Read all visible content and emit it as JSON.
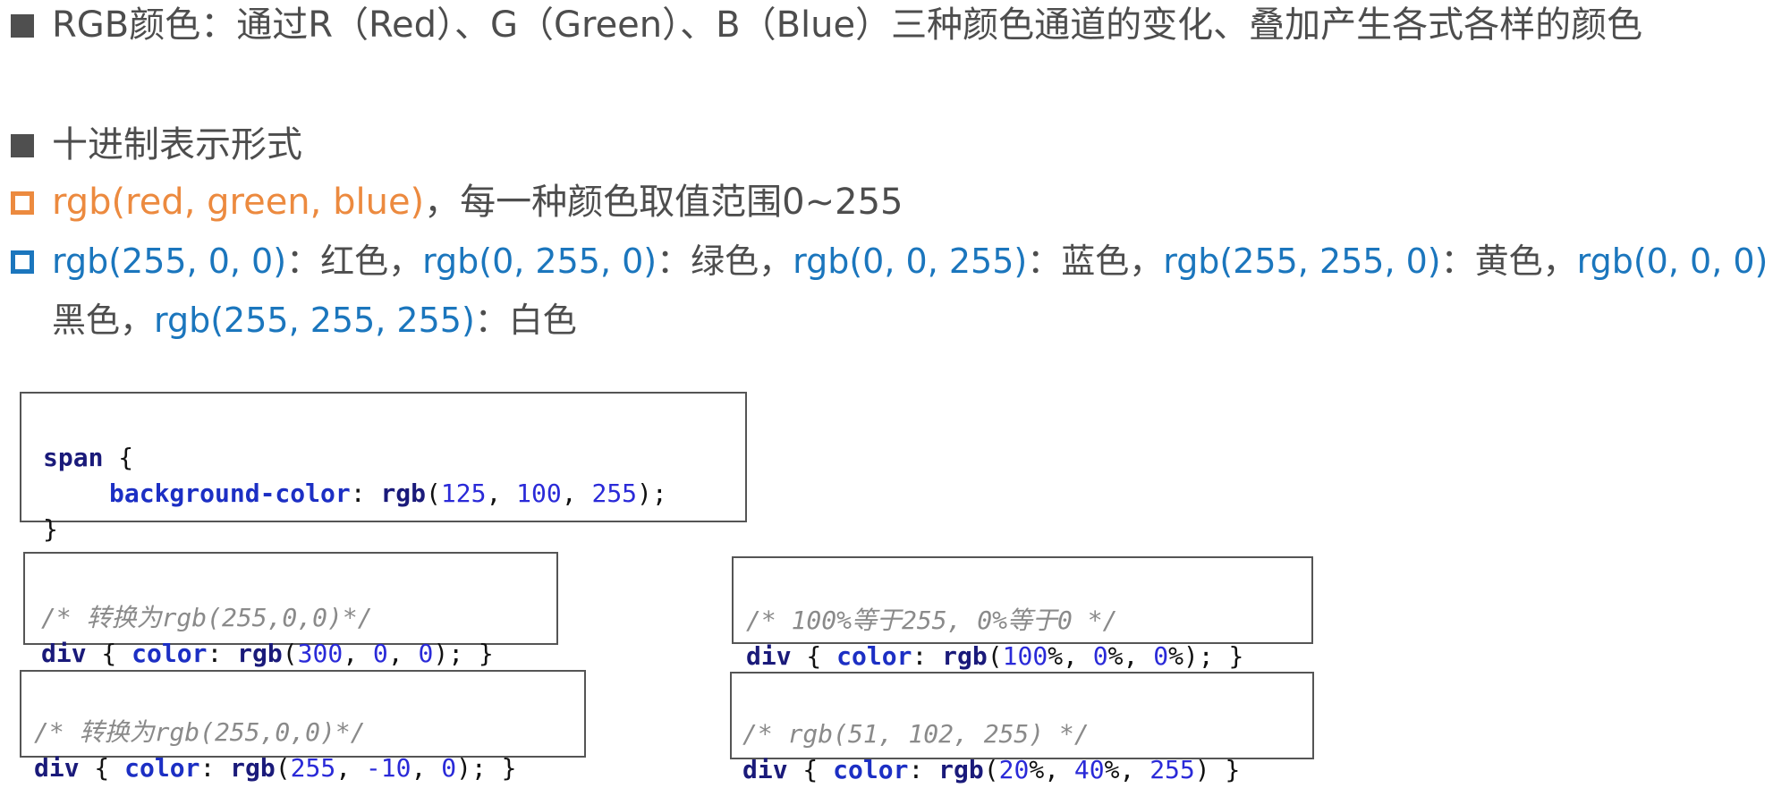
{
  "line1": "RGB颜色：通过R（Red）、G（Green）、B（Blue）三种颜色通道的变化、叠加产生各式各样的颜色",
  "line2": "十进制表示形式",
  "line3": {
    "code": "rgb(red, green, blue)",
    "text": "，每一种颜色取值范围0~255"
  },
  "line4": {
    "c1": "rgb(255, 0, 0)",
    "t1": "：红色，",
    "c2": "rgb(0, 255, 0)",
    "t2": "：绿色，",
    "c3": "rgb(0, 0, 255)",
    "t3": "：蓝色，",
    "c4": "rgb(255, 255, 0)",
    "t4": "：黄色，",
    "c5": "rgb(0, 0, 0)",
    "t5": "："
  },
  "line5": {
    "t0": "黑色，",
    "c6": "rgb(255, 255, 255)",
    "t6": "：白色"
  },
  "box_main": {
    "selector": "span",
    "open": " {",
    "property": "background-color",
    "colon": ": ",
    "fn": "rgb",
    "p_open": "(",
    "n1": "125",
    "sep1": ", ",
    "n2": "100",
    "sep2": ", ",
    "n3": "255",
    "p_close": ");",
    "close": "}"
  },
  "box_a": {
    "comment": "/* 转换为rgb(255,0,0)*/",
    "selector": "div",
    "open": " { ",
    "property": "color",
    "colon": ": ",
    "fn": "rgb",
    "p_open": "(",
    "n1": "300",
    "sep1": ", ",
    "n2": "0",
    "sep2": ", ",
    "n3": "0",
    "p_close": "); }"
  },
  "box_b": {
    "comment": "/* 100%等于255, 0%等于0 */",
    "selector": "div",
    "open": " { ",
    "property": "color",
    "colon": ": ",
    "fn": "rgb",
    "p_open": "(",
    "n1": "100",
    "u1": "%, ",
    "n2": "0",
    "u2": "%, ",
    "n3": "0",
    "u3": "%",
    "p_close": "); }"
  },
  "box_c": {
    "comment": "/* 转换为rgb(255,0,0)*/",
    "selector": "div",
    "open": " { ",
    "property": "color",
    "colon": ": ",
    "fn": "rgb",
    "p_open": "(",
    "n1": "255",
    "sep1": ", ",
    "n2": "-10",
    "sep2": ", ",
    "n3": "0",
    "p_close": "); }"
  },
  "box_d": {
    "comment": "/* rgb(51, 102, 255) */",
    "selector": "div",
    "open": " { ",
    "property": "color",
    "colon": ": ",
    "fn": "rgb",
    "p_open": "(",
    "n1": "20",
    "u1": "%, ",
    "n2": "40",
    "u2": "%, ",
    "n3": "255",
    "p_close": ") }"
  }
}
